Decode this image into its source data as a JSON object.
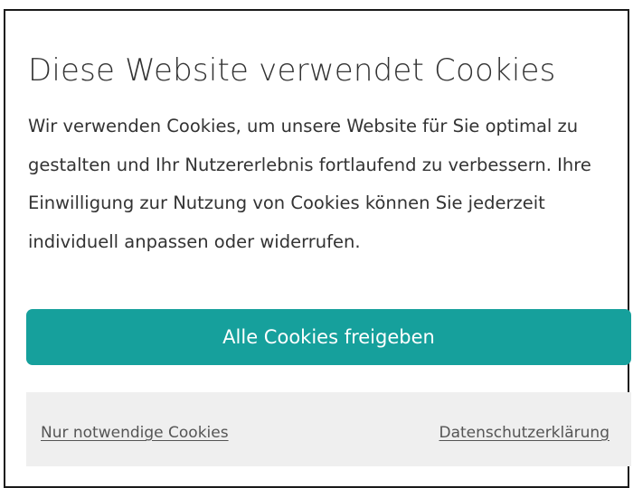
{
  "dialog": {
    "title": "Diese Website verwendet Cookies",
    "description": "Wir verwenden Cookies, um unsere Website für Sie optimal zu gestalten und Ihr Nutzererlebnis fortlaufend zu verbessern. Ihre Einwilligung zur Nutzung von Cookies können Sie jederzeit individuell anpassen oder widerrufen.",
    "accept_all_label": "Alle Cookies freigeben",
    "necessary_only_label": "Nur notwendige Cookies",
    "privacy_label": "Datenschutzerklärung"
  },
  "colors": {
    "accent": "#16a09c",
    "footer_background": "#efefef",
    "text": "#333333"
  }
}
